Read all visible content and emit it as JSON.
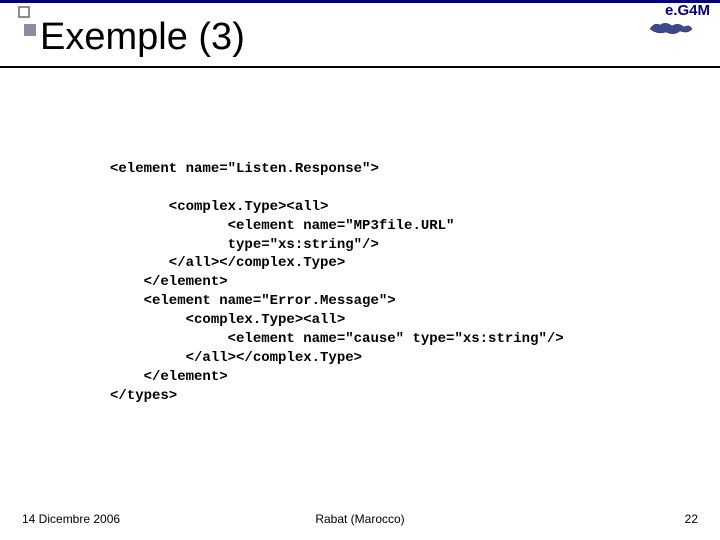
{
  "logo": {
    "text": "e.G4M"
  },
  "title": "Exemple (3)",
  "code": "<element name=\"Listen.Response\">\n\n       <complex.Type><all>\n              <element name=\"MP3file.URL\"\n              type=\"xs:string\"/>\n       </all></complex.Type>\n    </element>\n    <element name=\"Error.Message\">\n         <complex.Type><all>\n              <element name=\"cause\" type=\"xs:string\"/>\n         </all></complex.Type>\n    </element>\n</types>",
  "footer": {
    "date": "14 Dicembre 2006",
    "location": "Rabat (Marocco)",
    "page": "22"
  }
}
